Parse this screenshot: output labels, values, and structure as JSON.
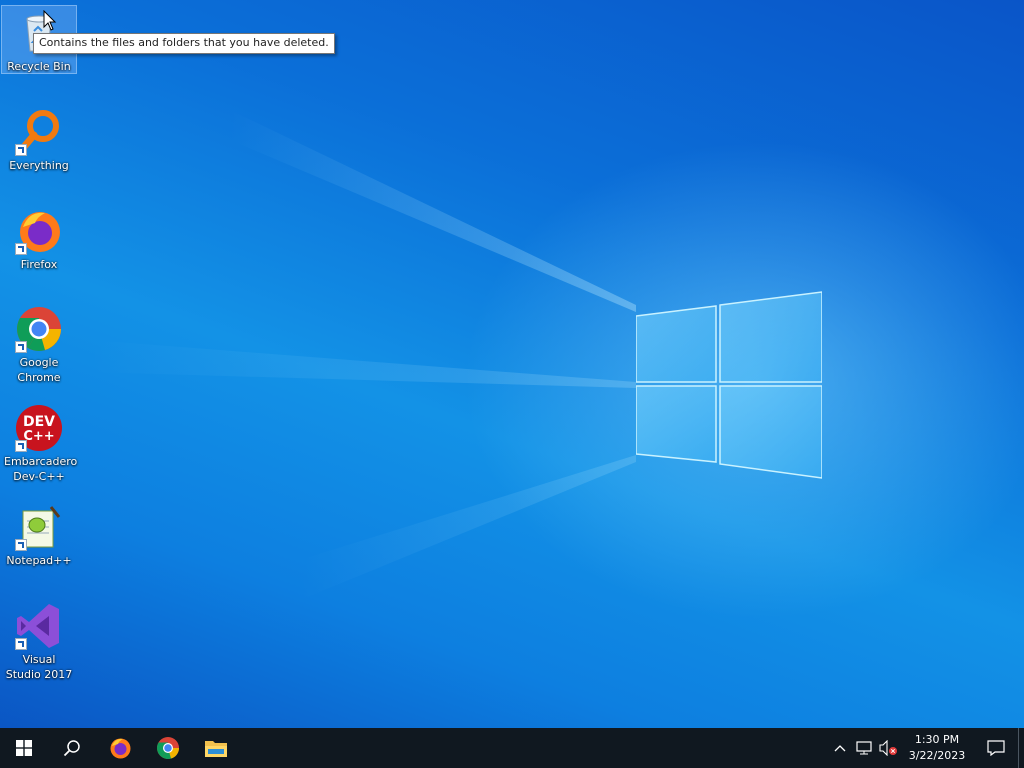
{
  "desktop": {
    "icons": [
      {
        "label": "Recycle Bin",
        "icon": "recycle-bin-icon"
      },
      {
        "label": "Everything",
        "icon": "everything-search-icon"
      },
      {
        "label": "Firefox",
        "icon": "firefox-icon"
      },
      {
        "label": "Google Chrome",
        "icon": "chrome-icon"
      },
      {
        "label": "Embarcadero Dev-C++",
        "icon": "dev-cpp-icon",
        "badge": "DEV C++"
      },
      {
        "label": "Notepad++",
        "icon": "notepad-plus-plus-icon"
      },
      {
        "label": "Visual Studio 2017",
        "icon": "visual-studio-icon"
      }
    ],
    "tooltip": "Contains the files and folders that you have deleted."
  },
  "taskbar": {
    "start": "windows-start-icon",
    "search": "search-icon",
    "pinned": [
      "firefox-icon",
      "chrome-icon",
      "file-explorer-icon"
    ],
    "tray": [
      "chevron-up-icon",
      "network-icon",
      "volume-muted-icon"
    ],
    "time": "1:30 PM",
    "date": "3/22/2023",
    "notification": "action-center-icon"
  },
  "colors": {
    "taskbar": "#101820",
    "desktop_accent": "#0b6fd8"
  }
}
